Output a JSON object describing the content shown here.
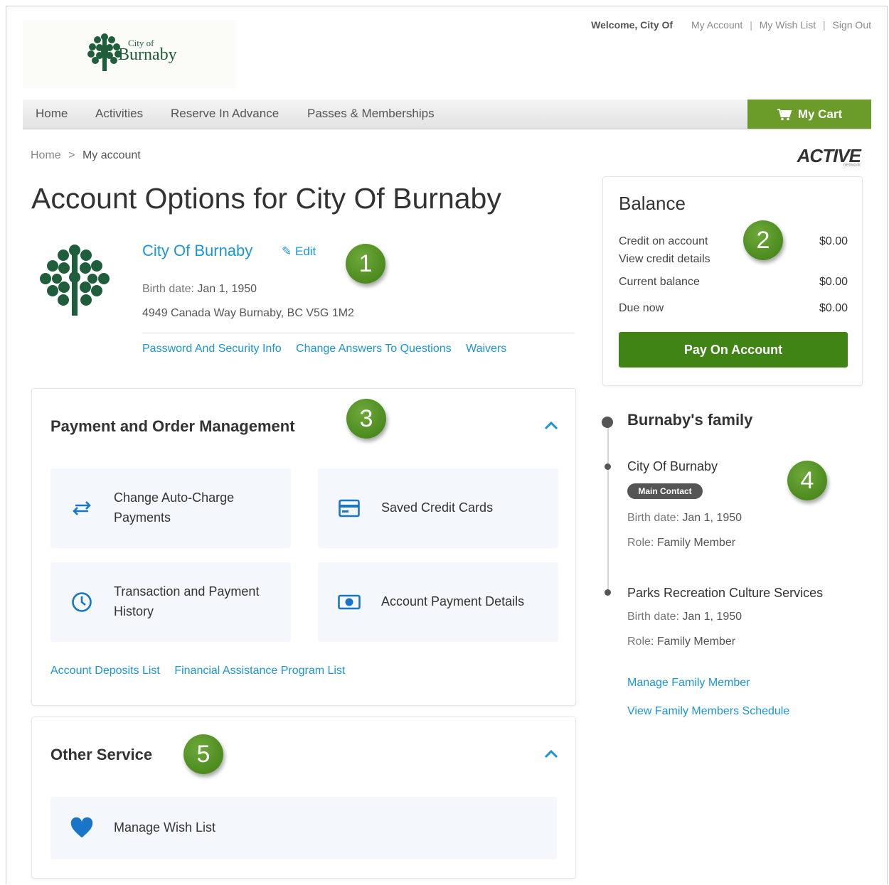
{
  "header": {
    "logo_small": "City of",
    "logo_big": "Burnaby",
    "welcome": "Welcome, City Of",
    "my_account": "My Account",
    "wish_list": "My Wish List",
    "sign_out": "Sign Out",
    "separator": "|"
  },
  "nav": {
    "items": [
      "Home",
      "Activities",
      "Reserve In Advance",
      "Passes & Memberships"
    ],
    "cart": "My Cart"
  },
  "breadcrumb": {
    "home": "Home",
    "sep": ">",
    "current": "My account"
  },
  "active_logo": {
    "text": "ACTIVE",
    "sub": "network"
  },
  "page_title": "Account Options for City Of Burnaby",
  "account": {
    "name": "City Of Burnaby",
    "edit": "Edit",
    "birth_label": "Birth date:",
    "birth_value": "Jan 1, 1950",
    "address": "4949 Canada Way Burnaby, BC V5G 1M2",
    "links": [
      "Password And Security Info",
      "Change Answers To Questions",
      "Waivers"
    ]
  },
  "badges": [
    "1",
    "2",
    "3",
    "4",
    "5"
  ],
  "payment": {
    "title": "Payment and Order Management",
    "tiles": [
      "Change Auto-Charge Payments",
      "Saved Credit Cards",
      "Transaction and Payment History",
      "Account Payment Details"
    ],
    "links": [
      "Account Deposits List",
      "Financial Assistance Program List"
    ]
  },
  "other": {
    "title": "Other Service",
    "tiles": [
      "Manage Wish List"
    ]
  },
  "balance": {
    "title": "Balance",
    "credit_label": "Credit on account",
    "credit_value": "$0.00",
    "credit_link": "View credit details",
    "current_label": "Current balance",
    "current_value": "$0.00",
    "due_label": "Due now",
    "due_value": "$0.00",
    "pay_button": "Pay On Account"
  },
  "family": {
    "title": "Burnaby's family",
    "members": [
      {
        "name": "City Of Burnaby",
        "badge": "Main Contact",
        "birth_label": "Birth date:",
        "birth": "Jan 1, 1950",
        "role_label": "Role:",
        "role": "Family Member"
      },
      {
        "name": "Parks Recreation Culture Services",
        "birth_label": "Birth date:",
        "birth": "Jan 1, 1950",
        "role_label": "Role:",
        "role": "Family Member"
      }
    ],
    "links": [
      "Manage Family Member",
      "View Family Members Schedule"
    ]
  },
  "colors": {
    "accent_blue": "#1a95d6",
    "green": "#3f8415",
    "cart_green": "#6b9c2a",
    "tile_bg": "#f4f8fc"
  }
}
